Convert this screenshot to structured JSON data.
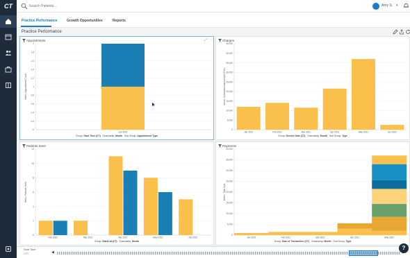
{
  "app": {
    "logo": "CT"
  },
  "search": {
    "placeholder": "Search Patients..."
  },
  "user": {
    "name": "Amy S."
  },
  "tabs": [
    {
      "label": "Practice Performance",
      "active": true
    },
    {
      "label": "Growth Opportunities",
      "active": false
    },
    {
      "label": "Reports",
      "active": false
    }
  ],
  "page": {
    "title": "Practice Performance"
  },
  "timeline": {
    "label": "Start Time",
    "sub": "UTC"
  },
  "colors": {
    "accent": "#1a7cc4",
    "yellow": "#fbbf4c",
    "blue": "#1a7fb4",
    "green": "#6aa06a",
    "rail": "#1e2b3a"
  },
  "chart_data": [
    {
      "type": "bar",
      "title": "Appointments",
      "ylabel": "Metric: Appointment Count",
      "categories": [
        "Jun 2021"
      ],
      "series": [
        {
          "values": [
            1
          ],
          "color": "#fbbf4c"
        },
        {
          "values": [
            1
          ],
          "color": "#1a7fb4"
        }
      ],
      "yticks": [
        0,
        0.2,
        0.4,
        0.6,
        0.8,
        1,
        1.2,
        1.4,
        1.6,
        1.8,
        2
      ],
      "ylim": [
        0,
        2
      ],
      "footer": [
        {
          "k": "Group:",
          "v": "Start Time (CT)"
        },
        {
          "k": "Granularity:",
          "v": "Month"
        },
        {
          "k": "Sub Group:",
          "v": "Appointment Type"
        }
      ]
    },
    {
      "type": "bar",
      "title": "Charges",
      "ylabel": "Metric: Scheduled Amount Sum (Fee)",
      "categories": [
        "Jan 2021",
        "Feb 2021",
        "Mar 2021",
        "Apr 2021",
        "May 2021",
        "Jun 2021"
      ],
      "series": [
        {
          "values": [
            12000,
            14000,
            11500,
            21500,
            37000,
            2500
          ],
          "color": "#fbbf4c"
        }
      ],
      "yticks": [
        0,
        5000,
        10000,
        15000,
        20000,
        25000,
        30000,
        35000,
        40000,
        45000
      ],
      "ylim": [
        0,
        45000
      ],
      "footer": [
        {
          "k": "Group:",
          "v": "Service Date (CT)"
        },
        {
          "k": "Granularity:",
          "v": "Month"
        },
        {
          "k": "Sub Group:",
          "v": "Type"
        }
      ]
    },
    {
      "type": "bar",
      "title": "Patients Seen",
      "ylabel": "Metric: Patients Seen",
      "categories": [
        "Feb 2021",
        "Mar 2021",
        "Apr 2021",
        "May 2021",
        "Jun 2021"
      ],
      "series": [
        {
          "values": [
            2,
            2,
            11,
            8,
            5
          ],
          "color": "#fbbf4c"
        },
        {
          "values": [
            2,
            0,
            9,
            6,
            0
          ],
          "color": "#1a7fb4"
        }
      ],
      "yticks": [
        0,
        2,
        4,
        6,
        8,
        10,
        12
      ],
      "ylim": [
        0,
        12
      ],
      "footer": [
        {
          "k": "Group:",
          "v": "Starts at (CT)"
        },
        {
          "k": "Granularity:",
          "v": "Month"
        }
      ]
    },
    {
      "type": "bar",
      "title": "Payments",
      "ylabel": "Metric: Total Sum",
      "categories": [
        "Jan 2021",
        "Feb 2021",
        "Mar 2021",
        "Apr 2021",
        "May 2021"
      ],
      "series": [
        {
          "values": [
            1000,
            1500,
            1500,
            3000,
            2000
          ],
          "color": "#fbbf4c"
        },
        {
          "values": [
            0,
            0,
            0,
            2500,
            6500
          ],
          "color": "#e8a632"
        },
        {
          "values": [
            0,
            0,
            0,
            0,
            6000
          ],
          "color": "#6aa06a"
        },
        {
          "values": [
            0,
            0,
            0,
            0,
            7000
          ],
          "color": "#fcd27a"
        },
        {
          "values": [
            0,
            0,
            0,
            0,
            4000
          ],
          "color": "#0d6e9e"
        },
        {
          "values": [
            0,
            0,
            0,
            0,
            7500
          ],
          "color": "#1a8fc4"
        },
        {
          "values": [
            0,
            0,
            0,
            0,
            4000
          ],
          "color": "#fbbf4c"
        }
      ],
      "yticks": [
        0,
        5000,
        10000,
        15000,
        20000,
        25000,
        30000,
        35000,
        40000
      ],
      "ylim": [
        0,
        40000
      ],
      "footer": [
        {
          "k": "Group:",
          "v": "Date of Transaction (CT)"
        },
        {
          "k": "Granularity:",
          "v": "Month"
        },
        {
          "k": "Sub Group:",
          "v": "Type"
        }
      ]
    }
  ]
}
